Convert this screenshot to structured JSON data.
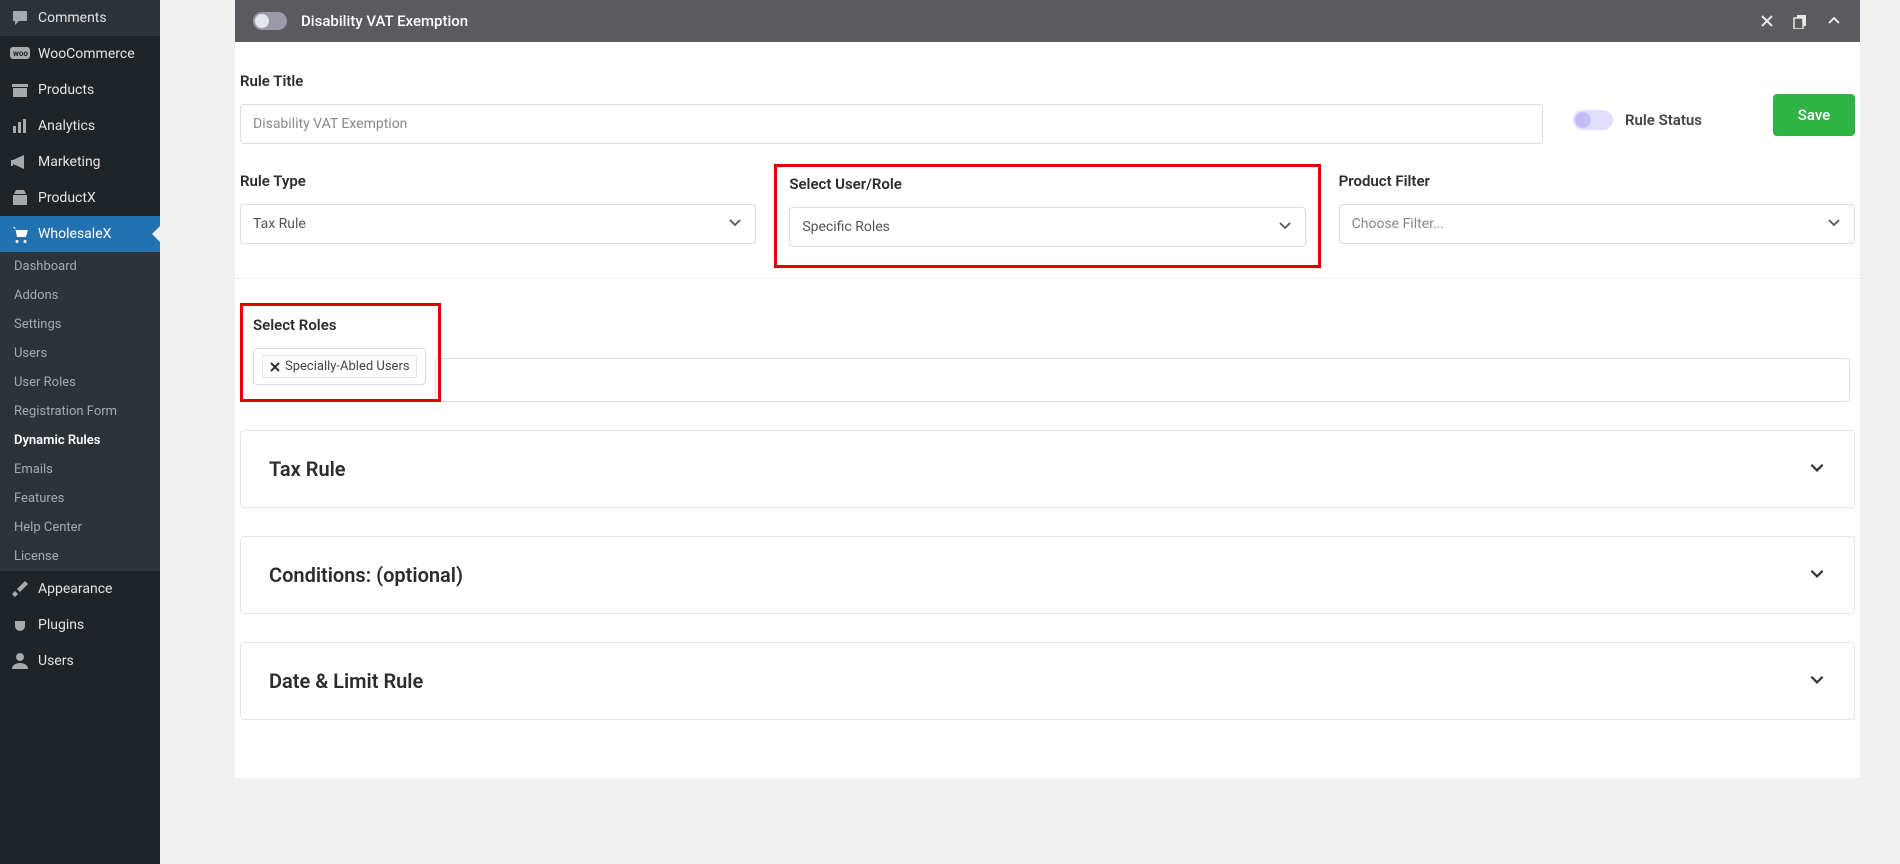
{
  "sidebar": {
    "main_items": [
      {
        "label": "Comments",
        "icon": "comment"
      },
      {
        "label": "WooCommerce",
        "icon": "woo"
      },
      {
        "label": "Products",
        "icon": "archive"
      },
      {
        "label": "Analytics",
        "icon": "chart"
      },
      {
        "label": "Marketing",
        "icon": "megaphone"
      },
      {
        "label": "ProductX",
        "icon": "shopping"
      },
      {
        "label": "WholesaleX",
        "icon": "cart",
        "active": true
      }
    ],
    "sub_items": [
      {
        "label": "Dashboard"
      },
      {
        "label": "Addons"
      },
      {
        "label": "Settings"
      },
      {
        "label": "Users"
      },
      {
        "label": "User Roles"
      },
      {
        "label": "Registration Form"
      },
      {
        "label": "Dynamic Rules",
        "active": true
      },
      {
        "label": "Emails"
      },
      {
        "label": "Features"
      },
      {
        "label": "Help Center"
      },
      {
        "label": "License"
      }
    ],
    "bottom_items": [
      {
        "label": "Appearance",
        "icon": "brush"
      },
      {
        "label": "Plugins",
        "icon": "plug"
      },
      {
        "label": "Users",
        "icon": "user"
      }
    ]
  },
  "panel": {
    "header_title": "Disability VAT Exemption"
  },
  "form": {
    "rule_title_label": "Rule Title",
    "rule_title_value": "Disability VAT Exemption",
    "rule_status_label": "Rule Status",
    "save_label": "Save",
    "rule_type_label": "Rule Type",
    "rule_type_value": "Tax Rule",
    "select_user_label": "Select User/Role",
    "select_user_value": "Specific Roles",
    "product_filter_label": "Product Filter",
    "product_filter_value": "Choose Filter...",
    "select_roles_label": "Select Roles",
    "role_tag": "Specially-Abled Users"
  },
  "accordions": {
    "tax_rule": "Tax Rule",
    "conditions": "Conditions: (optional)",
    "date_limit": "Date & Limit Rule"
  }
}
